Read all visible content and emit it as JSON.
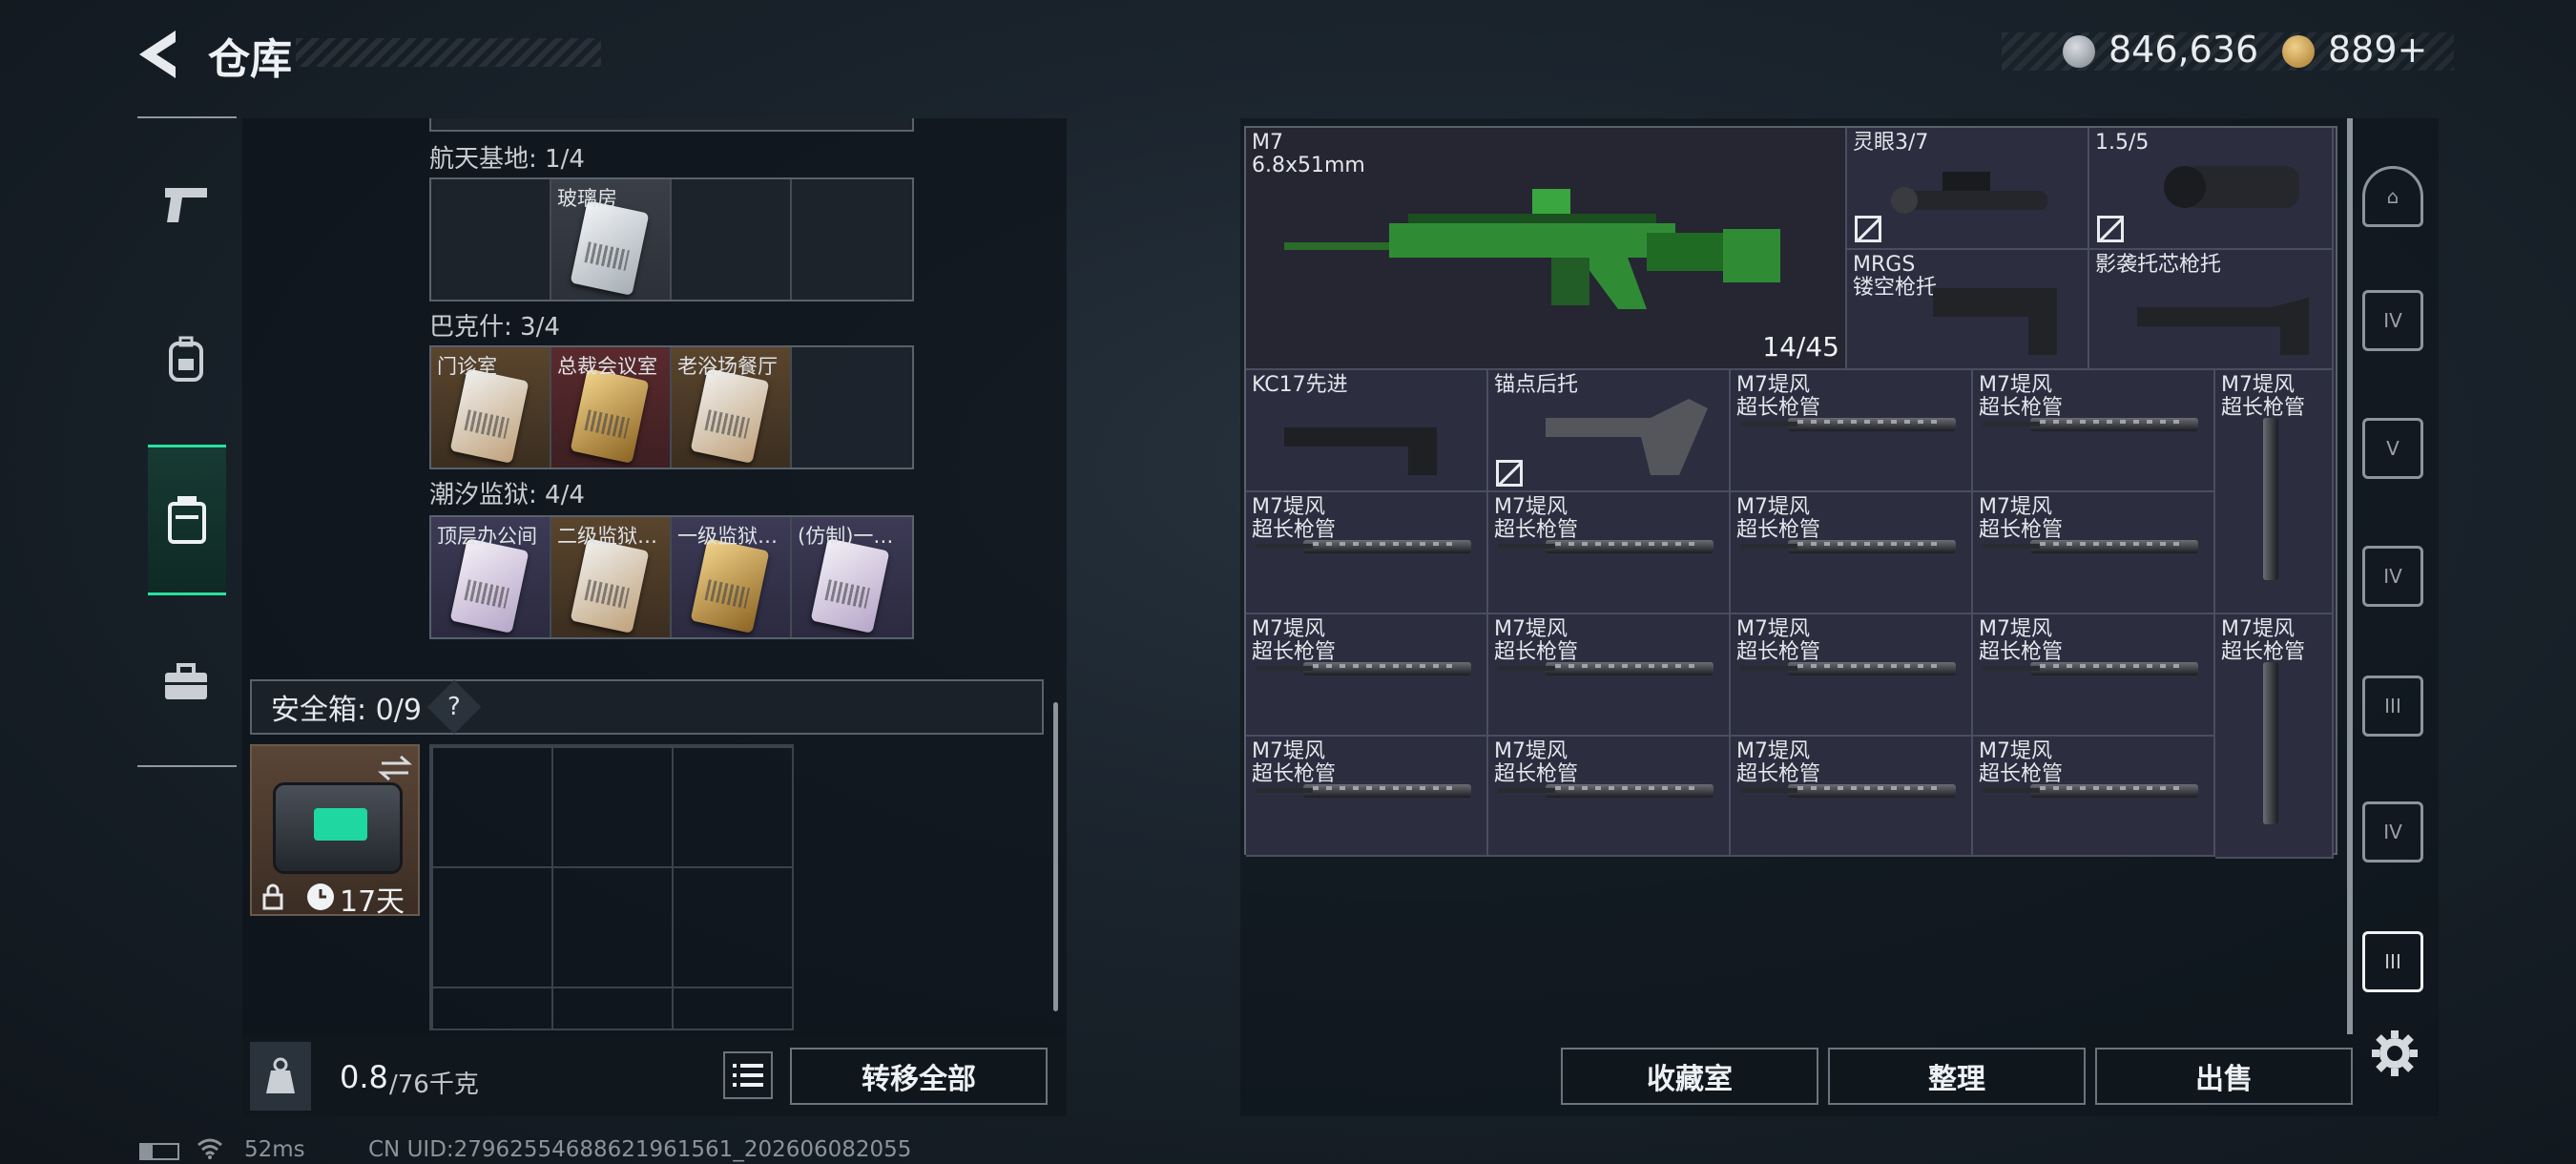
{
  "header": {
    "title": "仓库",
    "currency": [
      {
        "icon": "silver-coin-icon",
        "value": "846,636"
      },
      {
        "icon": "gold-coin-icon",
        "value": "889+"
      }
    ]
  },
  "nav": {
    "items": [
      {
        "icon": "pistol-icon"
      },
      {
        "icon": "backpack-icon"
      },
      {
        "icon": "storage-icon",
        "active": true
      },
      {
        "icon": "toolbox-icon"
      }
    ]
  },
  "keycards": {
    "groups": [
      {
        "label": "航天基地: 1/4",
        "cells": [
          {
            "name": "",
            "rarity": "empty"
          },
          {
            "name": "玻璃房",
            "rarity": "white"
          },
          {
            "name": "",
            "rarity": "empty"
          },
          {
            "name": "",
            "rarity": "empty"
          }
        ]
      },
      {
        "label": "巴克什: 3/4",
        "cells": [
          {
            "name": "门诊室",
            "rarity": "orange"
          },
          {
            "name": "总裁会议室",
            "rarity": "gold"
          },
          {
            "name": "老浴场餐厅",
            "rarity": "orange"
          },
          {
            "name": "",
            "rarity": "empty"
          }
        ]
      },
      {
        "label": "潮汐监狱: 4/4",
        "cells": [
          {
            "name": "顶层办公间",
            "rarity": "purple"
          },
          {
            "name": "二级监狱…",
            "rarity": "orange"
          },
          {
            "name": "一级监狱…",
            "rarity": "purple"
          },
          {
            "name": "(仿制)一…",
            "rarity": "purple"
          }
        ]
      }
    ]
  },
  "safe": {
    "label": "安全箱: 0/9",
    "help": "?",
    "timer": "17天"
  },
  "bottom_left": {
    "weight_current": "0.8",
    "weight_max": "/76千克",
    "transfer_all": "转移全部"
  },
  "weapons": {
    "main": {
      "name": "M7",
      "caliber": "6.8x51mm",
      "ammo": "14/45"
    },
    "scope1": "灵眼3/7",
    "scope2": "1.5/5",
    "stock1_line1": "MRGS",
    "stock1_line2": "镂空枪托",
    "stock2": "影袭托芯枪托",
    "stock3": "KC17先进",
    "stock4": "锚点后托",
    "barrel_line1": "M7堤风",
    "barrel_line2": "超长枪管"
  },
  "bottom_right": {
    "collection": "收藏室",
    "sort": "整理",
    "sell": "出售"
  },
  "status": {
    "ping": "52ms",
    "uid": "CN UID:27962554688621961561_202606082055"
  }
}
